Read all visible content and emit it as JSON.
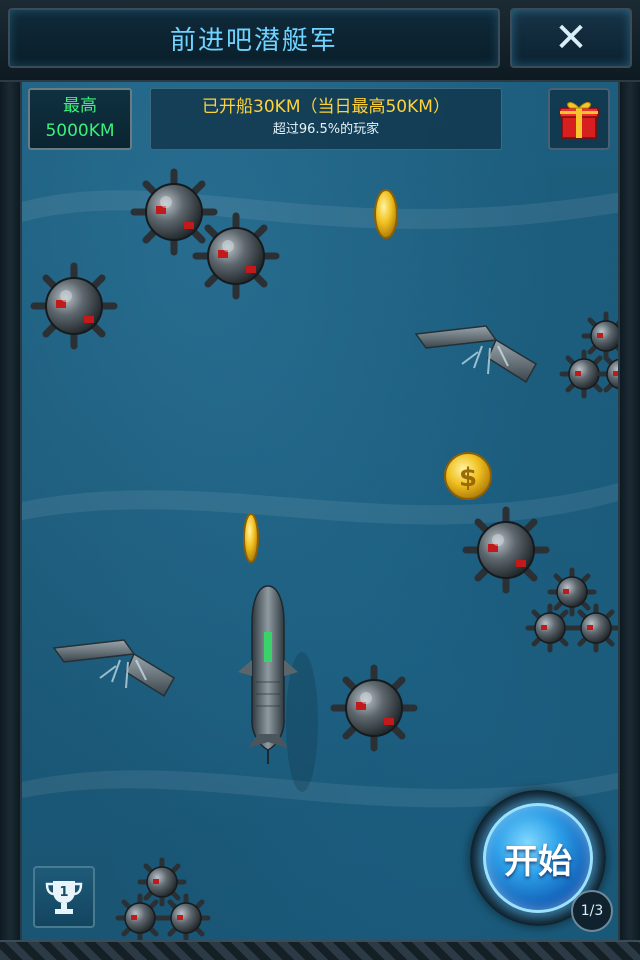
{
  "header": {
    "title": "前进吧潜艇军",
    "close_icon": "✕"
  },
  "hud": {
    "best_label": "最高",
    "best_value": "5000KM",
    "distance_text": "已开船30KM（当日最高50KM）",
    "rank_text": "超过96.5%的玩家",
    "gift_icon": "gift-box-icon"
  },
  "controls": {
    "start_label": "开始",
    "attempts": "1/3",
    "leaderboard_icon": "trophy-icon",
    "trophy_rank": "1"
  },
  "colors": {
    "title": "#6fd3ff",
    "best": "#3cf07a",
    "distance": "#ffd23a",
    "water": "#1d5e7e",
    "start_button": "#2d9fe8"
  },
  "scene": {
    "player": "submarine",
    "obstacles": [
      "sea-mine",
      "sea-mine",
      "sea-mine",
      "sea-mine",
      "sea-mine",
      "sunken-ship",
      "sunken-ship",
      "mine-cluster",
      "mine-cluster",
      "mine-cluster"
    ],
    "pickups": [
      "gold-coin",
      "gold-coin",
      "gold-coin"
    ]
  }
}
